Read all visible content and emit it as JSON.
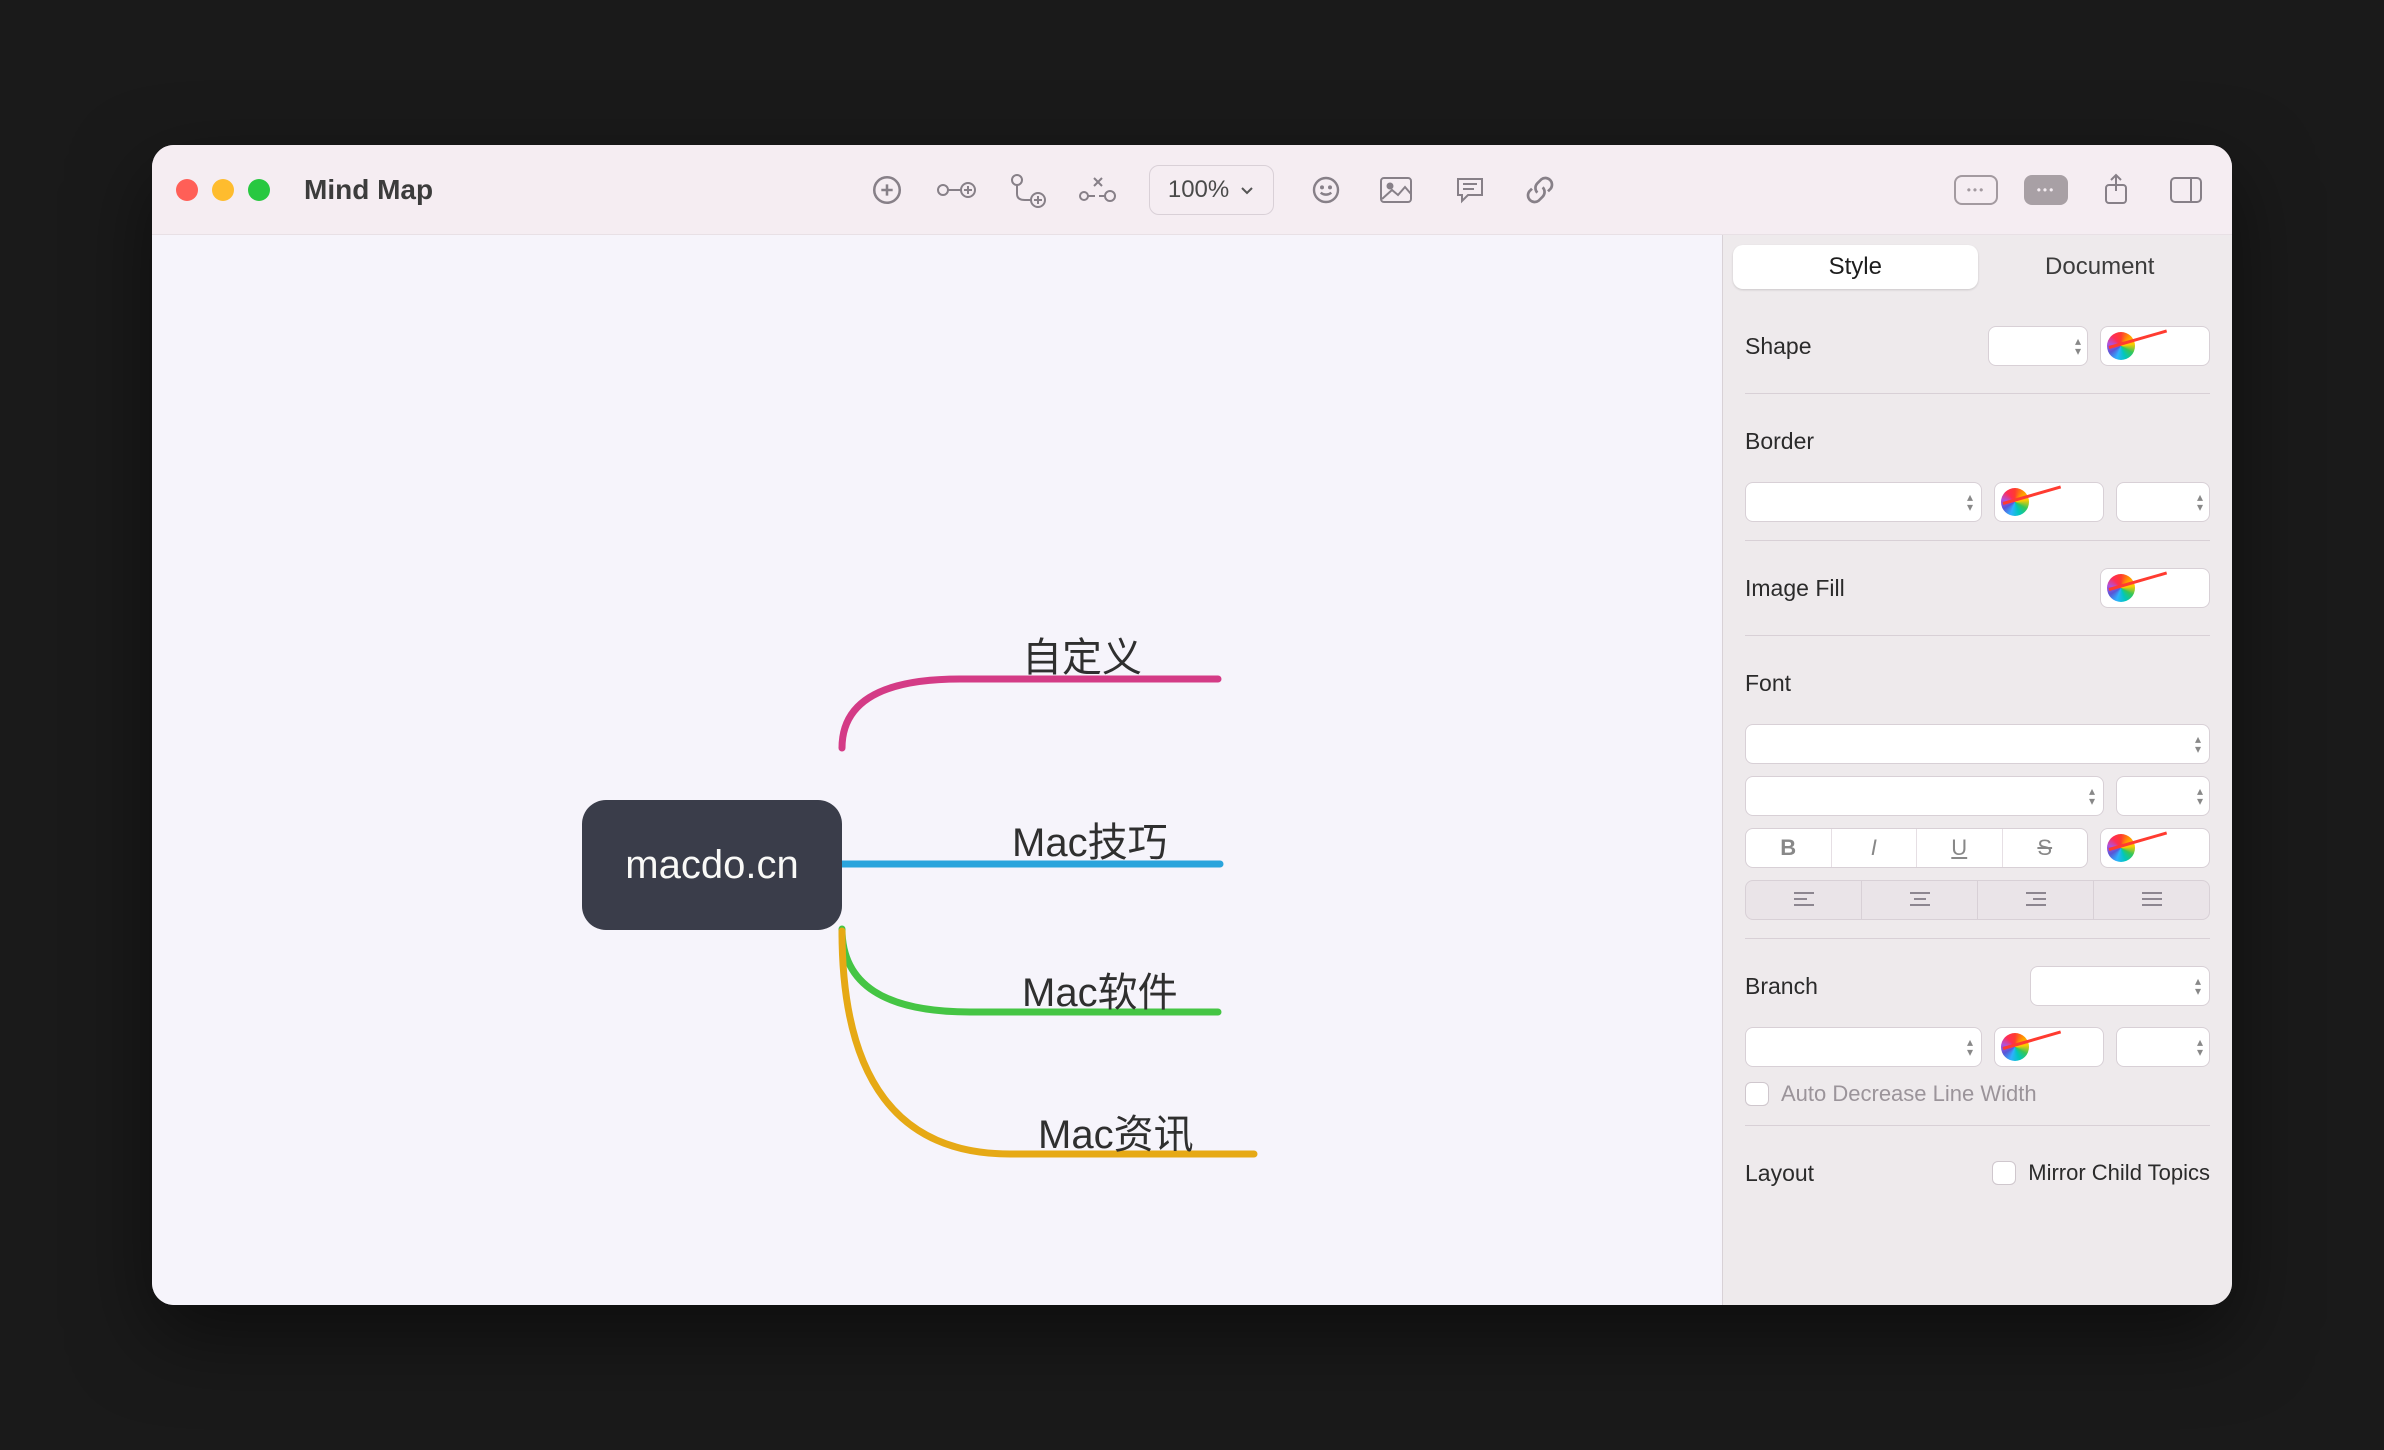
{
  "window": {
    "title": "Mind Map"
  },
  "toolbar": {
    "zoom": "100%"
  },
  "tabs": {
    "style": "Style",
    "document": "Document",
    "active": "style"
  },
  "inspector": {
    "shape_label": "Shape",
    "border_label": "Border",
    "image_fill_label": "Image Fill",
    "font_label": "Font",
    "branch_label": "Branch",
    "auto_decrease_label": "Auto Decrease Line Width",
    "layout_label": "Layout",
    "mirror_label": "Mirror Child Topics"
  },
  "mindmap": {
    "root": "macdo.cn",
    "branches": [
      {
        "label": "自定义",
        "color": "#d43b86"
      },
      {
        "label": "Mac技巧",
        "color": "#2aa4dc"
      },
      {
        "label": "Mac软件",
        "color": "#45c544"
      },
      {
        "label": "Mac资讯",
        "color": "#e6a915"
      }
    ]
  }
}
